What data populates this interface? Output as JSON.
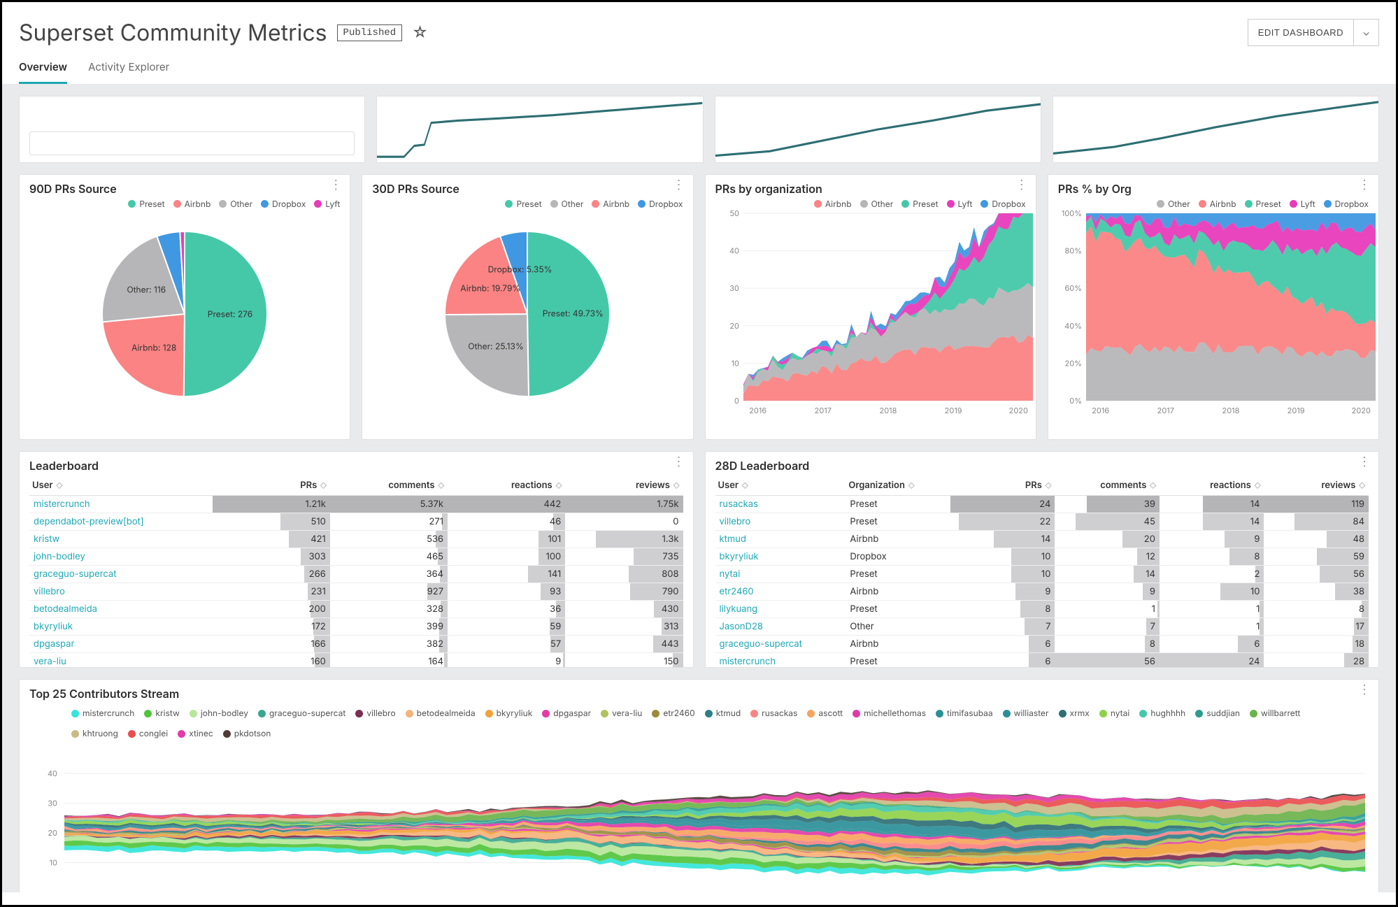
{
  "header": {
    "title": "Superset Community Metrics",
    "status_badge": "Published",
    "edit_button": "EDIT DASHBOARD"
  },
  "tabs": [
    {
      "label": "Overview",
      "active": true
    },
    {
      "label": "Activity Explorer",
      "active": false
    }
  ],
  "colors": {
    "preset": "#45c8a8",
    "airbnb": "#fb8383",
    "other": "#b6b6b8",
    "dropbox": "#4098e2",
    "lyft": "#e83bbb",
    "spark": "#2d6e72"
  },
  "cards": {
    "pie90": {
      "title": "90D PRs Source",
      "legend": [
        "Preset",
        "Airbnb",
        "Other",
        "Dropbox",
        "Lyft"
      ]
    },
    "pie30": {
      "title": "30D PRs Source",
      "legend": [
        "Preset",
        "Other",
        "Airbnb",
        "Dropbox"
      ]
    },
    "prs_org": {
      "title": "PRs by organization",
      "legend": [
        "Airbnb",
        "Other",
        "Preset",
        "Lyft",
        "Dropbox"
      ]
    },
    "prs_pct": {
      "title": "PRs % by Org",
      "legend": [
        "Other",
        "Airbnb",
        "Preset",
        "Lyft",
        "Dropbox"
      ]
    },
    "lb": {
      "title": "Leaderboard",
      "columns": [
        "User",
        "PRs",
        "comments",
        "reactions",
        "reviews"
      ]
    },
    "lb28": {
      "title": "28D Leaderboard",
      "columns": [
        "User",
        "Organization",
        "PRs",
        "comments",
        "reactions",
        "reviews"
      ]
    },
    "stream": {
      "title": "Top 25 Contributors Stream"
    }
  },
  "chart_data": [
    {
      "id": "pie90",
      "type": "pie",
      "title": "90D PRs Source",
      "series": [
        {
          "name": "Preset",
          "value": 276,
          "label": "Preset: 276"
        },
        {
          "name": "Airbnb",
          "value": 128,
          "label": "Airbnb: 128"
        },
        {
          "name": "Other",
          "value": 116,
          "label": "Other: 116"
        },
        {
          "name": "Dropbox",
          "value": 25,
          "label": ""
        },
        {
          "name": "Lyft",
          "value": 5,
          "label": ""
        }
      ]
    },
    {
      "id": "pie30",
      "type": "pie",
      "title": "30D PRs Source",
      "series": [
        {
          "name": "Preset",
          "value": 49.73,
          "label": "Preset: 49.73%"
        },
        {
          "name": "Other",
          "value": 25.13,
          "label": "Other: 25.13%"
        },
        {
          "name": "Airbnb",
          "value": 19.79,
          "label": "Airbnb: 19.79%"
        },
        {
          "name": "Dropbox",
          "value": 5.35,
          "label": "Dropbox: 5.35%"
        }
      ]
    },
    {
      "id": "prs_org",
      "type": "area",
      "title": "PRs by organization",
      "xlabel": "",
      "ylabel": "",
      "ylim": [
        0,
        50
      ],
      "x_ticks": [
        "2016",
        "2017",
        "2018",
        "2019",
        "2020"
      ],
      "y_ticks": [
        0,
        10,
        20,
        30,
        40,
        50
      ],
      "series_order": [
        "Airbnb",
        "Other",
        "Preset",
        "Lyft",
        "Dropbox"
      ],
      "note": "weekly PR counts per org, middle years peak near 30-40, 2020 stacks reach 50"
    },
    {
      "id": "prs_pct",
      "type": "area",
      "title": "PRs % by Org",
      "xlabel": "",
      "ylabel": "",
      "ylim": [
        0,
        100
      ],
      "y_format": "percent",
      "x_ticks": [
        "2016",
        "2017",
        "2018",
        "2019",
        "2020"
      ],
      "y_ticks": [
        0,
        20,
        40,
        60,
        80,
        100
      ],
      "series_order": [
        "Other",
        "Airbnb",
        "Preset",
        "Lyft",
        "Dropbox"
      ],
      "note": "100% stacked; Airbnb dominates 2016-2018, Preset+Lyft grow through 2019-2020"
    },
    {
      "id": "leaderboard",
      "type": "table",
      "columns": [
        "User",
        "PRs",
        "comments",
        "reactions",
        "reviews"
      ],
      "rows": [
        [
          "mistercrunch",
          "1.21k",
          "5.37k",
          "442",
          "1.75k"
        ],
        [
          "dependabot-preview[bot]",
          "510",
          "271",
          "46",
          "0"
        ],
        [
          "kristw",
          "421",
          "536",
          "101",
          "1.3k"
        ],
        [
          "john-bodley",
          "303",
          "465",
          "100",
          "735"
        ],
        [
          "graceguo-supercat",
          "266",
          "364",
          "141",
          "808"
        ],
        [
          "villebro",
          "231",
          "927",
          "93",
          "790"
        ],
        [
          "betodealmeida",
          "200",
          "328",
          "36",
          "430"
        ],
        [
          "bkyryliuk",
          "172",
          "399",
          "59",
          "313"
        ],
        [
          "dpgaspar",
          "166",
          "382",
          "57",
          "443"
        ],
        [
          "vera-liu",
          "160",
          "164",
          "9",
          "150"
        ]
      ],
      "max": {
        "PRs": 1210,
        "comments": 5370,
        "reactions": 442,
        "reviews": 1750
      }
    },
    {
      "id": "leaderboard28",
      "type": "table",
      "columns": [
        "User",
        "Organization",
        "PRs",
        "comments",
        "reactions",
        "reviews"
      ],
      "rows": [
        [
          "rusackas",
          "Preset",
          "24",
          "39",
          "14",
          "119"
        ],
        [
          "villebro",
          "Preset",
          "22",
          "45",
          "14",
          "84"
        ],
        [
          "ktmud",
          "Airbnb",
          "14",
          "20",
          "9",
          "48"
        ],
        [
          "bkyryliuk",
          "Dropbox",
          "10",
          "12",
          "8",
          "59"
        ],
        [
          "nytai",
          "Preset",
          "10",
          "14",
          "2",
          "56"
        ],
        [
          "etr2460",
          "Airbnb",
          "9",
          "9",
          "10",
          "38"
        ],
        [
          "lilykuang",
          "Preset",
          "8",
          "1",
          "1",
          "8"
        ],
        [
          "JasonD28",
          "Other",
          "7",
          "7",
          "1",
          "17"
        ],
        [
          "graceguo-supercat",
          "Airbnb",
          "6",
          "8",
          "6",
          "18"
        ],
        [
          "mistercrunch",
          "Preset",
          "6",
          "56",
          "24",
          "28"
        ]
      ],
      "max": {
        "PRs": 24,
        "comments": 56,
        "reactions": 24,
        "reviews": 119
      }
    },
    {
      "id": "stream",
      "type": "area",
      "title": "Top 25 Contributors Stream",
      "y_ticks": [
        10,
        20,
        30,
        40
      ],
      "legend": [
        "mistercrunch",
        "kristw",
        "john-bodley",
        "graceguo-supercat",
        "villebro",
        "betodealmeida",
        "bkyryliuk",
        "dpgaspar",
        "vera-liu",
        "etr2460",
        "ktmud",
        "rusackas",
        "ascott",
        "michellethomas",
        "timifasubaa",
        "williaster",
        "xrmx",
        "nytai",
        "hughhhh",
        "suddjian",
        "willbarrett",
        "khtruong",
        "conglei",
        "xtinec",
        "pkdotson"
      ],
      "legend_colors": [
        "#34e5d8",
        "#52c43c",
        "#b7e69a",
        "#3aa88e",
        "#7d2c52",
        "#f6b27a",
        "#f2a23b",
        "#e23ba7",
        "#b1c25f",
        "#9a8b3d",
        "#2f7f86",
        "#fb8383",
        "#f6a45e",
        "#e23ba7",
        "#2b8f98",
        "#2b8f98",
        "#2e6f74",
        "#8fd14b",
        "#45c8a8",
        "#2d9b8e",
        "#6bb24a",
        "#c9bb88",
        "#e94e4e",
        "#e23ba7",
        "#4f3b35"
      ]
    }
  ]
}
